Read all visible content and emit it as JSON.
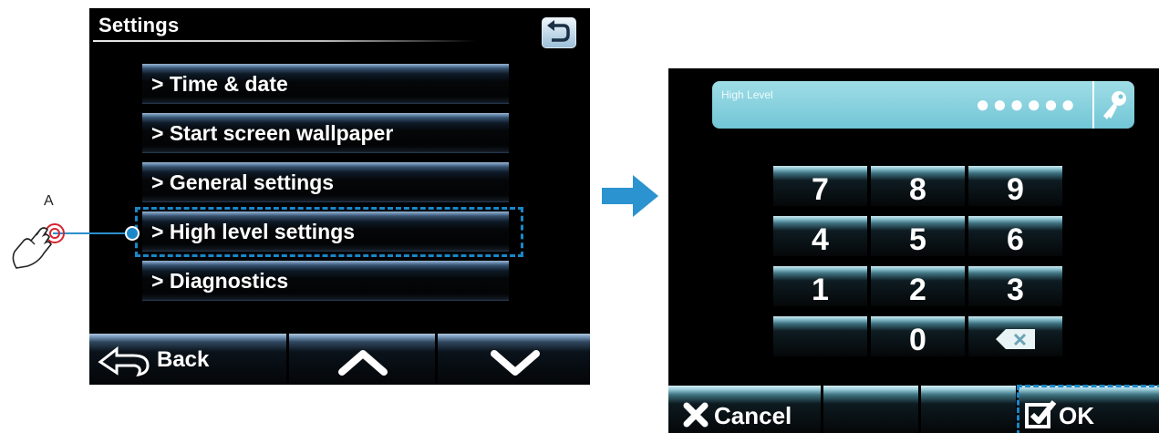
{
  "settings_screen": {
    "title": "Settings",
    "menu_items": [
      "> Time & date",
      "> Start screen wallpaper",
      "> General settings",
      "> High level settings",
      "> Diagnostics"
    ],
    "back_label": "Back",
    "icons": [
      "return-icon",
      "back-arrow-icon",
      "chevron-up-icon",
      "chevron-down-icon"
    ]
  },
  "annotation": {
    "label": "A",
    "highlight_color": "#1a87c8"
  },
  "keypad_screen": {
    "password_label": "High Level",
    "password_mask": "●●●●●●",
    "keys": [
      "7",
      "8",
      "9",
      "4",
      "5",
      "6",
      "1",
      "2",
      "3",
      "",
      "0",
      "⌫"
    ],
    "cancel_label": "Cancel",
    "ok_label": "OK",
    "accent": "#72c6d6"
  }
}
